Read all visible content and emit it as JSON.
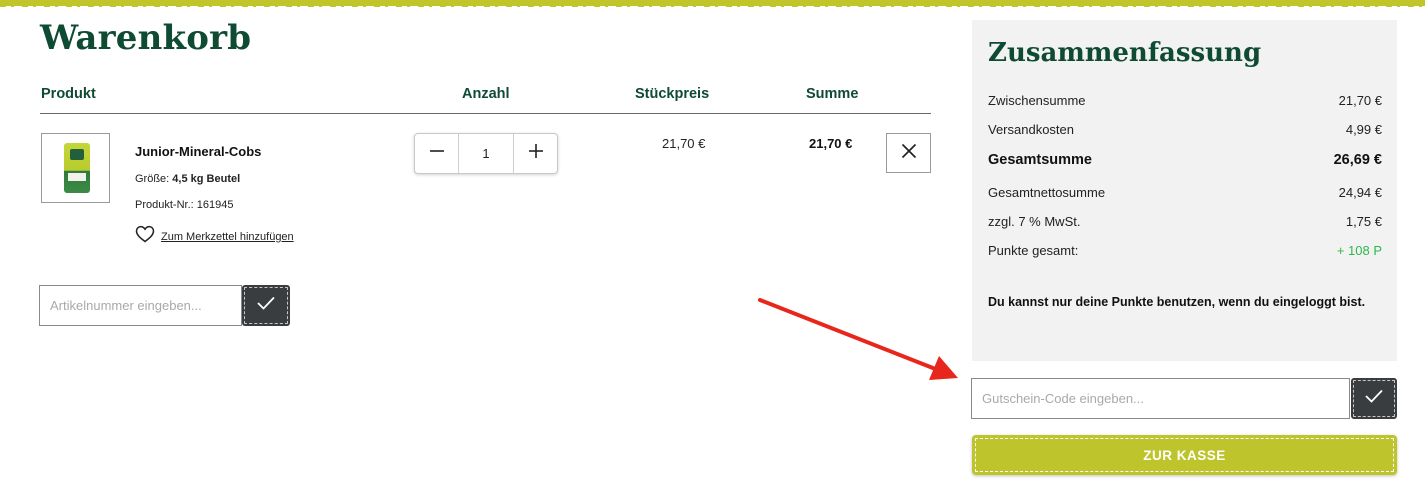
{
  "cart": {
    "title": "Warenkorb",
    "headers": {
      "product": "Produkt",
      "quantity": "Anzahl",
      "unit_price": "Stückpreis",
      "total": "Summe"
    },
    "item": {
      "name": "Junior-Mineral-Cobs",
      "size_label": "Größe:",
      "size_value": "4,5 kg Beutel",
      "product_nr_label": "Produkt-Nr.:",
      "product_nr_value": "161945",
      "wishlist_label": "Zum Merkzettel hinzufügen",
      "quantity": "1",
      "unit_price": "21,70 €",
      "line_total": "21,70 €"
    },
    "article_input": {
      "placeholder": "Artikelnummer eingeben..."
    }
  },
  "summary": {
    "title": "Zusammenfassung",
    "subtotal_label": "Zwischensumme",
    "subtotal_value": "21,70 €",
    "shipping_label": "Versandkosten",
    "shipping_value": "4,99 €",
    "grand_total_label": "Gesamtsumme",
    "grand_total_value": "26,69 €",
    "net_total_label": "Gesamtnettosumme",
    "net_total_value": "24,94 €",
    "vat_label": "zzgl. 7 % MwSt.",
    "vat_value": "1,75 €",
    "points_label": "Punkte gesamt:",
    "points_value": "+ 108 P",
    "login_note": "Du kannst nur deine Punkte benutzen, wenn du eingeloggt bist."
  },
  "voucher": {
    "placeholder": "Gutschein-Code eingeben..."
  },
  "checkout": {
    "label": "ZUR KASSE"
  },
  "colors": {
    "brand_green": "#0f4a33",
    "accent_lime": "#bec52c",
    "points_green": "#2db84d",
    "dark_button": "#3a3d40",
    "annotation_arrow": "#e8261c"
  },
  "icons": {
    "minus": "minus-icon",
    "plus": "plus-icon",
    "remove": "close-icon",
    "wishlist": "heart-icon",
    "confirm": "checkmark-icon"
  }
}
